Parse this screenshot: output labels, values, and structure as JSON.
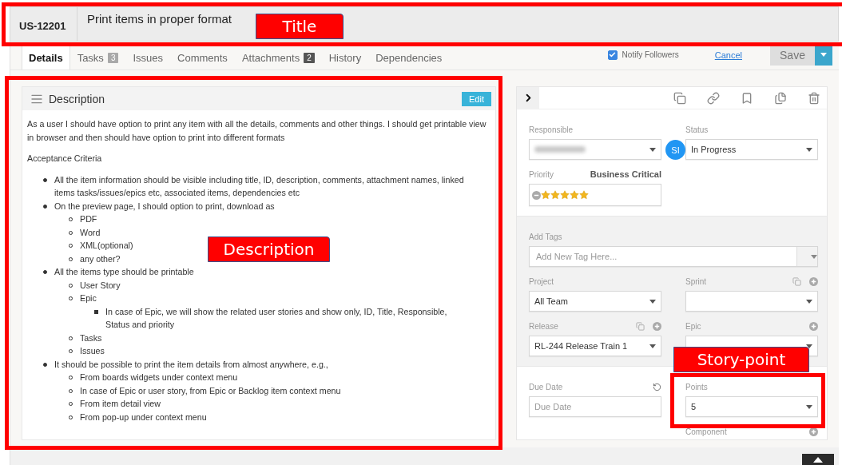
{
  "header": {
    "id": "US-12201",
    "title": "Print items in proper format"
  },
  "tabs": [
    {
      "label": "Details",
      "selected": true
    },
    {
      "label": "Tasks",
      "selected": false,
      "badge": "3",
      "color": "#a9a9a9"
    },
    {
      "label": "Issues",
      "selected": false
    },
    {
      "label": "Comments",
      "selected": false
    },
    {
      "label": "Attachments",
      "selected": false,
      "badge": "2",
      "color": "#555555"
    },
    {
      "label": "History",
      "selected": false
    },
    {
      "label": "Dependencies",
      "selected": false
    }
  ],
  "notify": {
    "label": "Notify Followers",
    "checked": true
  },
  "cancel": "Cancel",
  "save": "Save",
  "description": {
    "heading": "Description",
    "edit": "Edit",
    "paragraphs": [
      "As a user I should have option to print any item with all the details, comments and other things. I should get printable view in browser and then should have option to print into different formats",
      "Acceptance Criteria"
    ],
    "items": [
      {
        "text": "All the item information should be visible including title, ID, description, comments, attachment names, linked items tasks/issues/epics etc, associated items, dependencies etc"
      },
      {
        "text": "On the preview page, I should option to print, download as",
        "children": [
          {
            "text": "PDF"
          },
          {
            "text": "Word"
          },
          {
            "text": "XML(optional)"
          },
          {
            "text": "any other?"
          }
        ]
      },
      {
        "text": "All the items type should be printable",
        "children": [
          {
            "text": "User Story"
          },
          {
            "text": "Epic",
            "children": [
              {
                "text": "In case of Epic, we will show the related user stories and show only, ID, Title, Responsible, Status and priority"
              }
            ]
          },
          {
            "text": "Tasks"
          },
          {
            "text": "Issues"
          }
        ]
      },
      {
        "text": "It should be possible to print the item details from almost anywhere, e.g.,",
        "children": [
          {
            "text": "From boards widgets under context menu"
          },
          {
            "text": "In case of Epic or user story, from Epic or Backlog item context menu"
          },
          {
            "text": "From item detail view"
          },
          {
            "text": "From pop-up under context menu"
          }
        ]
      }
    ]
  },
  "details": {
    "sections": [
      {
        "shaded": false,
        "fields": [
          {
            "kind": "select",
            "label": "Responsible",
            "redacted": true,
            "avatar": "SI"
          },
          {
            "kind": "select",
            "label": "Status",
            "value": "In Progress"
          },
          {
            "kind": "stars",
            "label": "Priority",
            "note": "Business Critical",
            "stars": 5
          }
        ]
      },
      {
        "shaded": true,
        "fields": [
          {
            "kind": "tags",
            "label": "Add Tags",
            "placeholder": "Add New Tag Here..."
          },
          {
            "kind": "select",
            "label": "Project",
            "value": "All Team"
          },
          {
            "kind": "select",
            "label": "Sprint",
            "copy_button": true,
            "add_button": true
          },
          {
            "kind": "select",
            "label": "Release",
            "value": "RL-244 Release Train 1",
            "copy_button": true,
            "add_button": true
          },
          {
            "kind": "select",
            "label": "Epic",
            "add_button": true
          }
        ]
      },
      {
        "shaded": false,
        "fields": [
          {
            "kind": "input",
            "label": "Due Date",
            "placeholder": "Due Date",
            "reset_button": true
          },
          {
            "kind": "select",
            "label": "Points",
            "value": "5"
          },
          {
            "kind": "spacer"
          },
          {
            "kind": "label",
            "label": "Component",
            "add_button": true
          }
        ]
      }
    ]
  },
  "annotations": [
    {
      "kind": "header",
      "label": "Title"
    },
    {
      "kind": "description",
      "label": "Description"
    },
    {
      "kind": "points",
      "label": "Story-point"
    }
  ]
}
